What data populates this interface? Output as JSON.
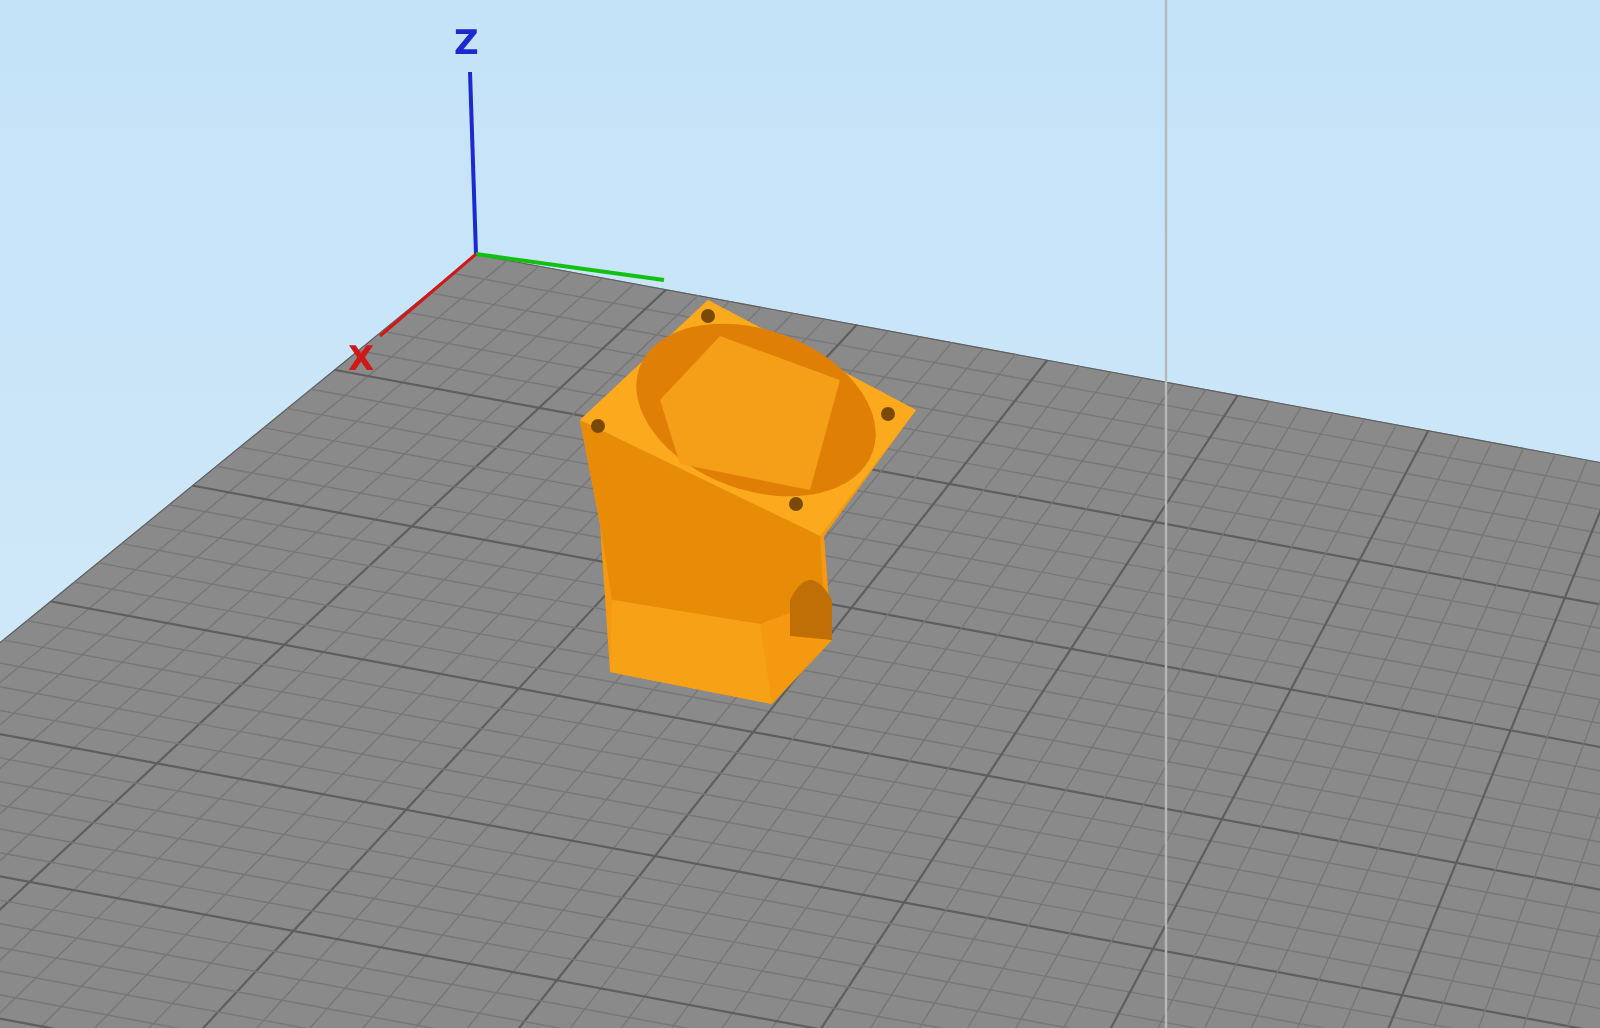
{
  "viewport": {
    "axes": [
      {
        "kind": "z",
        "label": "Z"
      },
      {
        "kind": "x",
        "label": "X"
      }
    ]
  }
}
